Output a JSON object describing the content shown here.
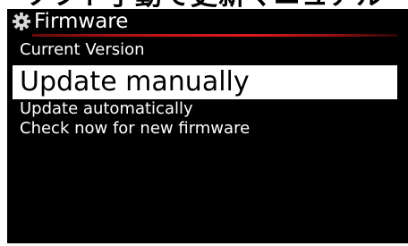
{
  "overlay_caption": "ソフト手動で更新マニュアル",
  "screen": {
    "title": "Firmware",
    "title_icon": "gear-icon",
    "accent_color": "#c41616",
    "menu": [
      {
        "label": "Current Version",
        "selected": false
      },
      {
        "label": "Update manually",
        "selected": true
      },
      {
        "label": "Update automatically",
        "selected": false
      },
      {
        "label": "Check now for new firmware",
        "selected": false
      }
    ]
  }
}
